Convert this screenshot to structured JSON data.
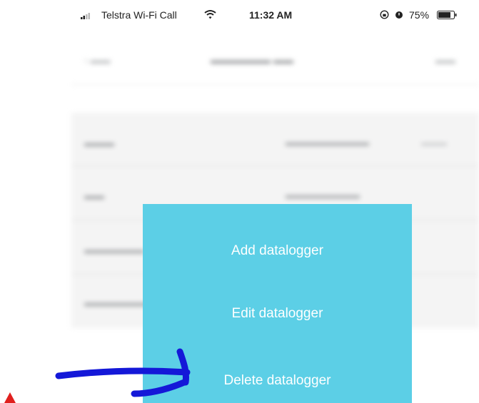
{
  "status_bar": {
    "carrier": "Telstra Wi-Fi Call",
    "time": "11:32 AM",
    "battery_percent": "75%"
  },
  "popup_menu": {
    "items": [
      {
        "label": "Add datalogger"
      },
      {
        "label": "Edit datalogger"
      },
      {
        "label": "Delete datalogger"
      }
    ]
  },
  "colors": {
    "menu_background": "#5ccfe6",
    "annotation_arrow": "#1418d8",
    "annotation_marker": "#e0201e"
  },
  "icons": [
    "signal-icon",
    "wifi-icon",
    "lock-rotation-icon",
    "alarm-icon",
    "battery-icon"
  ]
}
